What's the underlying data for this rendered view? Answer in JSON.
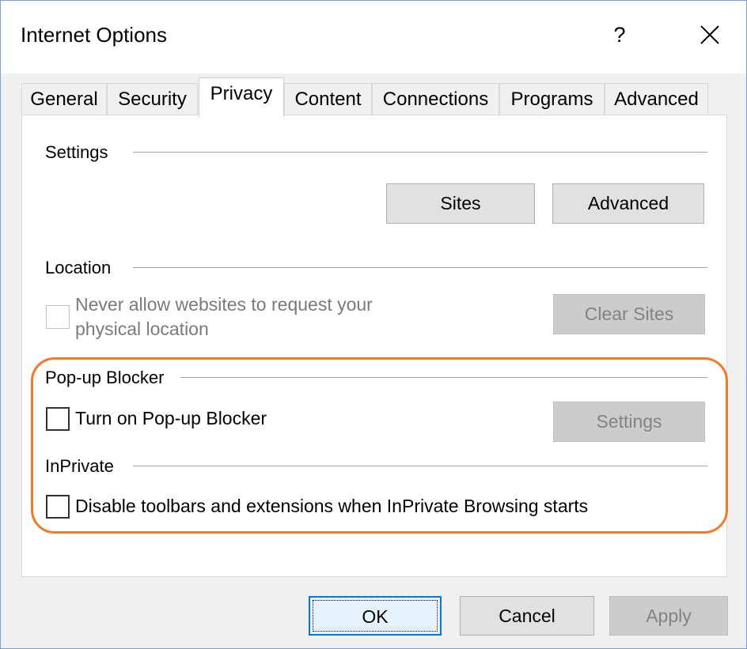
{
  "window": {
    "title": "Internet Options",
    "help_label": "?"
  },
  "tabs": [
    {
      "label": "General"
    },
    {
      "label": "Security"
    },
    {
      "label": "Privacy",
      "active": true
    },
    {
      "label": "Content"
    },
    {
      "label": "Connections"
    },
    {
      "label": "Programs"
    },
    {
      "label": "Advanced"
    }
  ],
  "settings": {
    "title": "Settings",
    "sites_button": "Sites",
    "advanced_button": "Advanced"
  },
  "location": {
    "title": "Location",
    "checkbox_label_line1": "Never allow websites to request your",
    "checkbox_label_line2": "physical location",
    "checkbox_checked": false,
    "checkbox_enabled": false,
    "clear_sites_button": "Clear Sites"
  },
  "popup_blocker": {
    "title": "Pop-up Blocker",
    "checkbox_label": "Turn on Pop-up Blocker",
    "checkbox_checked": false,
    "settings_button": "Settings"
  },
  "inprivate": {
    "title": "InPrivate",
    "checkbox_label": "Disable toolbars and extensions when InPrivate Browsing starts",
    "checkbox_checked": false
  },
  "footer": {
    "ok_label": "OK",
    "cancel_label": "Cancel",
    "apply_label": "Apply"
  },
  "colors": {
    "highlight": "#f07a28",
    "window_border": "#7a9fd6",
    "default_button_border": "#0078d7"
  }
}
